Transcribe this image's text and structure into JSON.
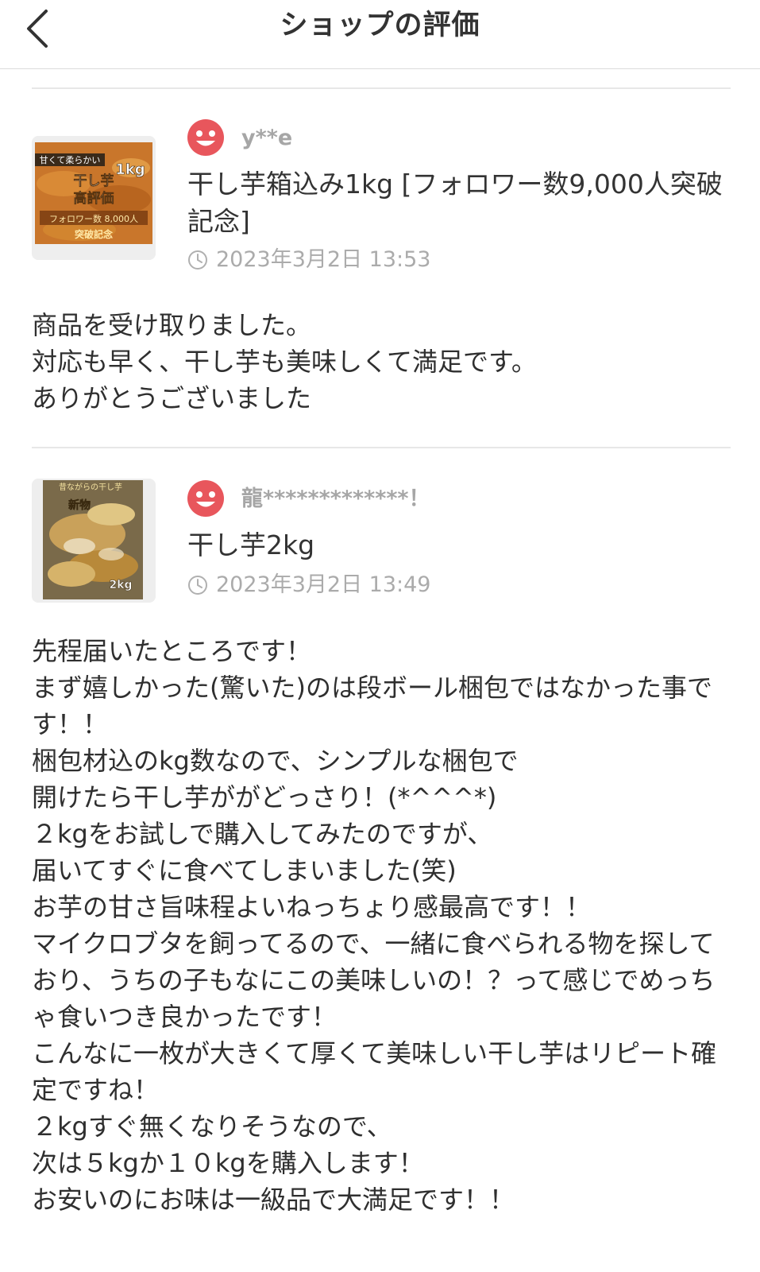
{
  "header": {
    "title": "ショップの評価"
  },
  "reviews": [
    {
      "thumb": {
        "tag": "甘くて柔らかい",
        "weight": "1kg",
        "line1": "干し芋",
        "line2": "高評価",
        "line3": "フォロワー数 8,000人",
        "line4": "突破記念"
      },
      "username": "y**e",
      "item_title": "干し芋箱込み1kg [フォロワー数9,000人突破記念]",
      "date": "2023年3月2日 13:53",
      "comment": "商品を受け取りました。\n対応も早く、干し芋も美味しくて満足です。\nありがとうございました"
    },
    {
      "thumb": {
        "tag": "昔ながらの干し芋",
        "badge": "新物",
        "weight": "2kg"
      },
      "username": "龍*************！",
      "item_title": "干し芋2kg",
      "date": "2023年3月2日 13:49",
      "comment": "先程届いたところです！\nまず嬉しかった(驚いた)のは段ボール梱包ではなかった事です！！\n梱包材込のkg数なので、シンプルな梱包で\n開けたら干し芋ががどっさり！(*^^^*)\n２kgをお試しで購入してみたのですが、\n届いてすぐに食べてしまいました(笑)\nお芋の甘さ旨味程よいねっちょり感最高です！！\nマイクロブタを飼ってるので、一緒に食べられる物を探しており、うちの子もなにこの美味しいの！？って感じでめっちゃ食いつき良かったです！\nこんなに一枚が大きくて厚くて美味しい干し芋はリピート確定ですね！\n２kgすぐ無くなりそうなので、\n次は５kgか１０kgを購入します！\nお安いのにお味は一級品で大満足です！！"
    }
  ],
  "colors": {
    "avatar": "#e8565c",
    "divider": "#e7e7e7",
    "meta_text": "#ababab"
  }
}
